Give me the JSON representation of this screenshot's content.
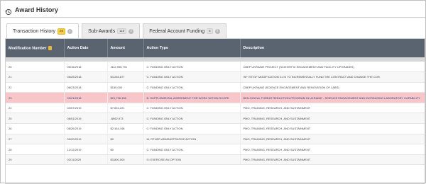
{
  "app": {
    "title": "Award History",
    "title_icon": "history-icon"
  },
  "tabs": [
    {
      "label": "Transaction History",
      "count": "26",
      "active": true
    },
    {
      "label": "Sub-Awards",
      "count": "115",
      "active": false
    },
    {
      "label": "Federal Account Funding",
      "count": "6",
      "active": false
    }
  ],
  "table": {
    "columns": [
      "Modification Number",
      "Action Date",
      "Amount",
      "Action Type",
      "Description"
    ],
    "rows": [
      {
        "mod": "20",
        "date": "05/16/2018",
        "amount": "-$12,955,791",
        "type": "C: FUNDING ONLY ACTION",
        "desc": "CBEP UKRAINE PROJECT (SCIENTIFIC ENGAGEMENT AND FACILITY UPGRADES)"
      },
      {
        "mod": "21",
        "date": "05/25/2018",
        "amount": "$4,265,677",
        "type": "C: FUNDING ONLY ACTION",
        "desc": "ISF IST/GF MODIFICATION 21 IS TO INCREMENTALLY FUND THE CONTRACT AND CHANGE THE COR."
      },
      {
        "mod": "22",
        "date": "08/23/2018",
        "amount": "$150,000",
        "type": "C: FUNDING ONLY ACTION",
        "desc": "CBEP UKRAINE (SCIENCE ENGAGEMENT AND RENOVATION OF LABS)"
      },
      {
        "mod": "23",
        "date": "09/21/2018",
        "amount": "$21,796,198",
        "type": "B: SUPPLEMENTAL AGREEMENT FOR WORK WITHIN SCOPE",
        "desc": "BIOLOGICAL THREAT REDUCTION PROGRAM IN UKRAINE - SCIENCE ENGAGEMENT AND INCREASING LABORATORY CAPABILITY",
        "highlight": true
      },
      {
        "mod": "24",
        "date": "03/07/2019",
        "amount": "$7,694,221",
        "type": "C: FUNDING ONLY ACTION",
        "desc": "PMO, TRAINING, RESEARCH, AND SUSTAINMENT"
      },
      {
        "mod": "25",
        "date": "08/01/2019",
        "amount": "-$962,973",
        "type": "C: FUNDING ONLY ACTION",
        "desc": "PMO, TRAINING, RESEARCH, AND SUSTAINMENT"
      },
      {
        "mod": "26",
        "date": "08/26/2019",
        "amount": "$2,154,196",
        "type": "C: FUNDING ONLY ACTION",
        "desc": "PMO, TRAINING, RESEARCH, AND SUSTAINMENT"
      },
      {
        "mod": "27",
        "date": "09/20/2019",
        "amount": "$0",
        "type": "M: OTHER ADMINISTRATIVE ACTION",
        "desc": "PMO, TRAINING, RESEARCH, AND SUSTAINMENT"
      },
      {
        "mod": "28",
        "date": "12/12/2019",
        "amount": "$0",
        "type": "C: FUNDING ONLY ACTION",
        "desc": "PMO, TRAINING, RESEARCH, AND SUSTAINMENT"
      },
      {
        "mod": "29",
        "date": "02/11/2020",
        "amount": "$3,800,000",
        "type": "G: EXERCISE AN OPTION",
        "desc": "PMO, TRAINING, RESEARCH, AND SUSTAINMENT"
      }
    ]
  }
}
